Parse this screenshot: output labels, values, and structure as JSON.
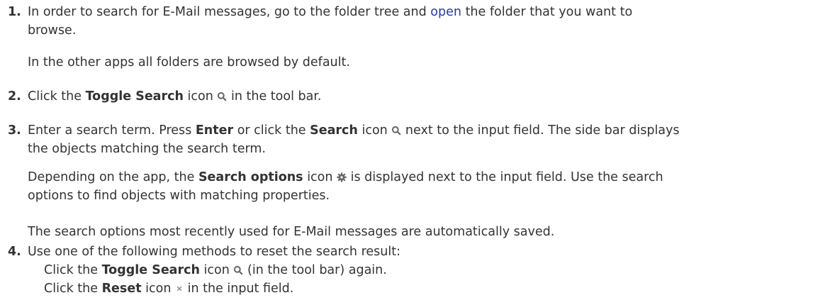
{
  "steps": [
    {
      "number": "1.",
      "line1": "In order to search for E-Mail messages, go to the folder tree and",
      "link": "open",
      "line1_end": "the folder that you want to",
      "line2": "browse.",
      "note": "In the other apps all folders are browsed by default."
    },
    {
      "number": "2.",
      "pre": "Click the",
      "bold": "Toggle Search",
      "mid": "icon",
      "post": "in the tool bar."
    },
    {
      "number": "3.",
      "pre1": "Enter a search term. Press",
      "bold1": "Enter",
      "mid1": "or click the",
      "bold2": "Search",
      "mid2": "icon",
      "post1": "next to the input field. The side bar displays",
      "line2": "the objects matching the search term.",
      "opt_pre": "Depending on the app, the",
      "opt_bold": "Search options",
      "opt_mid": "icon",
      "opt_post": "is displayed next to the input field. Use the search",
      "opt_line2": "options to find objects with matching properties.",
      "note": "The search options most recently used for E-Mail messages are automatically saved."
    },
    {
      "number": "4.",
      "text": "Use one of the following methods to reset the search result:",
      "methods": [
        {
          "pre": "Click the",
          "bold": "Toggle Search",
          "mid": "icon",
          "post": "(in the tool bar) again."
        },
        {
          "pre": "Click the",
          "bold": "Reset",
          "mid": "icon",
          "post": "in the input field."
        }
      ]
    }
  ],
  "colors": {
    "text": "#333333",
    "link": "#2a3c9e",
    "icon": "#666666"
  },
  "icons": [
    "search-icon",
    "gear-icon",
    "close-icon"
  ]
}
